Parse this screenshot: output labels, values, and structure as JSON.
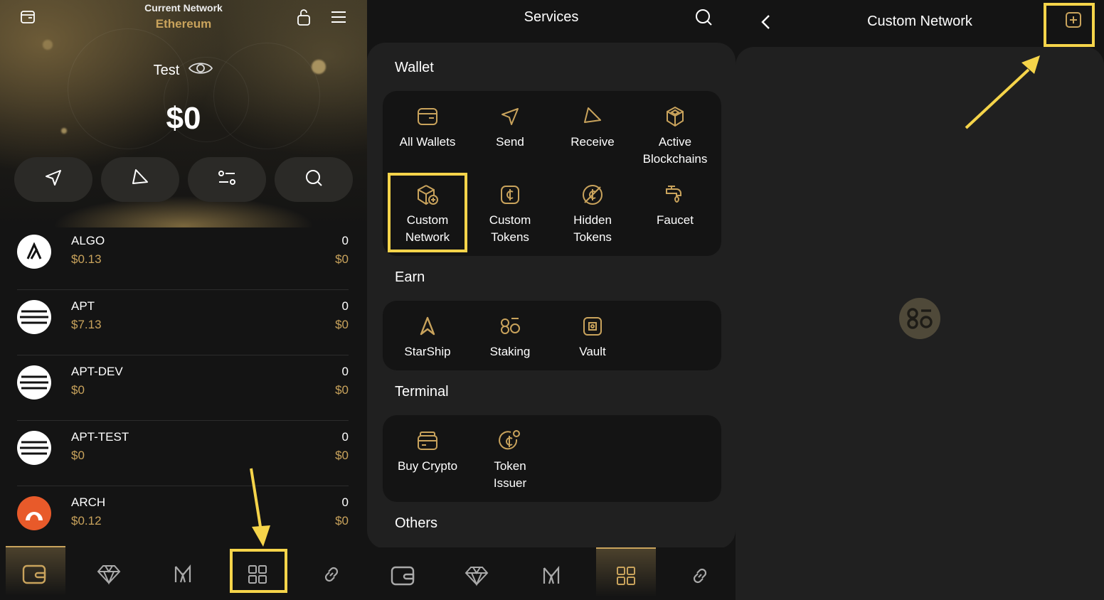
{
  "colors": {
    "accent": "#c9a35c",
    "highlight": "#f5d44a",
    "card": "#141414",
    "surface": "#202020"
  },
  "wallet_home": {
    "header": {
      "network_caption": "Current Network",
      "network_name": "Ethereum"
    },
    "account_name": "Test",
    "balance": "$0",
    "quick_actions": [
      "send-icon",
      "receive-icon",
      "swap-icon",
      "search-icon"
    ],
    "assets": [
      {
        "symbol": "ALGO",
        "price": "$0.13",
        "amount": "0",
        "value": "$0"
      },
      {
        "symbol": "APT",
        "price": "$7.13",
        "amount": "0",
        "value": "$0"
      },
      {
        "symbol": "APT-DEV",
        "price": "$0",
        "amount": "0",
        "value": "$0"
      },
      {
        "symbol": "APT-TEST",
        "price": "$0",
        "amount": "0",
        "value": "$0"
      },
      {
        "symbol": "ARCH",
        "price": "$0.12",
        "amount": "0",
        "value": "$0"
      }
    ],
    "nav": [
      "wallet-icon",
      "diamond-icon",
      "starship-icon",
      "services-icon",
      "link-icon"
    ]
  },
  "services": {
    "title": "Services",
    "sections": [
      {
        "title": "Wallet",
        "items": [
          "All Wallets",
          "Send",
          "Receive",
          "Active\nBlockchains",
          "Custom\nNetwork",
          "Custom\nTokens",
          "Hidden\nTokens",
          "Faucet"
        ]
      },
      {
        "title": "Earn",
        "items": [
          "StarShip",
          "Staking",
          "Vault"
        ]
      },
      {
        "title": "Terminal",
        "items": [
          "Buy Crypto",
          "Token\nIssuer"
        ]
      },
      {
        "title": "Others",
        "items": []
      }
    ]
  },
  "custom_network": {
    "title": "Custom Network"
  }
}
